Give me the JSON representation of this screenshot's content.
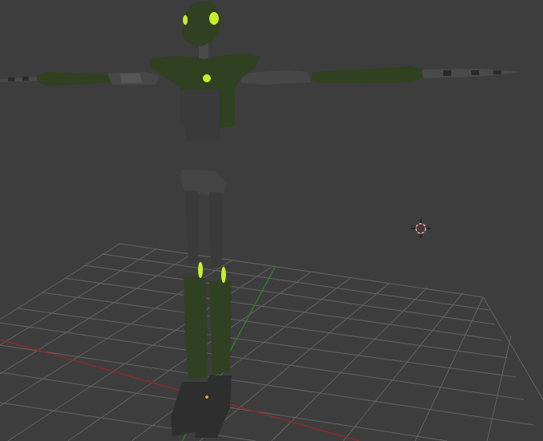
{
  "viewport": {
    "background": "#3d3d3d",
    "grid_color": "#6b6b6b",
    "x_axis_color": "#8a2a2a",
    "y_axis_color": "#2e7d2e"
  },
  "model": {
    "body_color": "#2f4120",
    "limb_color": "#3a3a3a",
    "glow_color": "#c8f02a",
    "origin_color": "#e0a030"
  },
  "icons": {
    "cursor": "3d-cursor-icon",
    "origin": "object-origin-icon"
  }
}
